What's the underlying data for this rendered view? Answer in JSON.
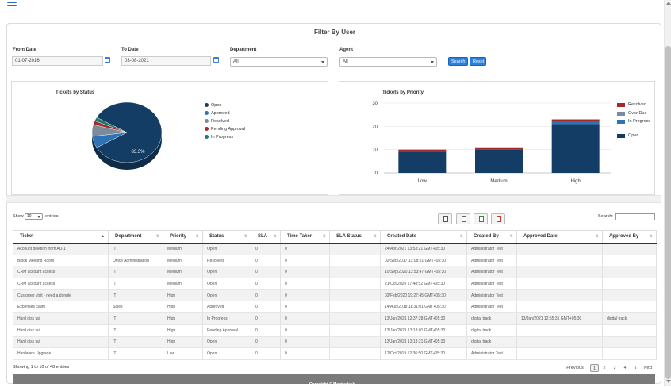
{
  "panel": {
    "title": "Filter By User"
  },
  "filters": {
    "from_date": {
      "label": "From Date",
      "value": "01-07-2016"
    },
    "to_date": {
      "label": "To Date",
      "value": "03-08-2021"
    },
    "department": {
      "label": "Department",
      "value": "All"
    },
    "agent": {
      "label": "Agent",
      "value": "All"
    },
    "search_label": "Search",
    "reset_label": "Reset"
  },
  "status_chart": {
    "title": "Tickets by Status",
    "slice_label": "83.3%",
    "legend": [
      {
        "label": "Open",
        "color": "#143d66"
      },
      {
        "label": "Approved",
        "color": "#2e74b5"
      },
      {
        "label": "Resolved",
        "color": "#7d8a99"
      },
      {
        "label": "Pending Approval",
        "color": "#a52a2a"
      },
      {
        "label": "In Progress",
        "color": "#1f7a6a"
      }
    ]
  },
  "chart_data": [
    {
      "type": "pie",
      "title": "Tickets by Status",
      "labels": [
        "Open",
        "Approved",
        "Resolved",
        "Pending Approval",
        "In Progress"
      ],
      "values": [
        83.3,
        6.3,
        6.3,
        2.1,
        2.0
      ],
      "colors": [
        "#143d66",
        "#2e74b5",
        "#7d8a99",
        "#a52a2a",
        "#1f7a6a"
      ],
      "legend": "right"
    },
    {
      "type": "bar",
      "title": "Tickets by Priority",
      "categories": [
        "Low",
        "Medium",
        "High"
      ],
      "series": [
        {
          "name": "Open",
          "values": [
            9,
            10,
            21
          ],
          "color": "#143d66"
        },
        {
          "name": "In Progress",
          "values": [
            0,
            0,
            1
          ],
          "color": "#2e74b5"
        },
        {
          "name": "Over Due",
          "values": [
            0,
            0,
            0
          ],
          "color": "#7d8a99"
        },
        {
          "name": "Resolved",
          "values": [
            1,
            1,
            1
          ],
          "color": "#a52a2a"
        }
      ],
      "ylim": [
        0,
        30
      ],
      "yticks": [
        0,
        10,
        20,
        30
      ],
      "grid": true,
      "legend": "right",
      "stacked": true
    }
  ],
  "priority_chart": {
    "title": "Tickets by Priority",
    "legend": [
      {
        "label": "Resolved",
        "color": "#a52a2a"
      },
      {
        "label": "Over Due",
        "color": "#7d8a99"
      },
      {
        "label": "In Progress",
        "color": "#2e74b5"
      },
      {
        "label": "Open",
        "color": "#143d66"
      }
    ]
  },
  "table_controls": {
    "show_label": "Show",
    "entries_value": "10",
    "entries_label": "entries",
    "search_label": "Search:",
    "info": "Showing 1 to 10 of 48 entries",
    "previous": "Previous",
    "pages": [
      "1",
      "2",
      "3",
      "4",
      "5"
    ],
    "next": "Next"
  },
  "table": {
    "headers": [
      "Ticket",
      "Department",
      "Priority",
      "Status",
      "SLA",
      "Time Taken",
      "SLA Status",
      "Created Date",
      "Created By",
      "Approved Date",
      "Approved By"
    ],
    "rows": [
      [
        "Account deletion from AD-1",
        "IT",
        "Medium",
        "Open",
        "0",
        "0",
        "",
        "24/Apr/2021 13:53:21 GMT+05:30",
        "Administrator Test",
        "",
        ""
      ],
      [
        "Block Meeting Room",
        "Office Administration",
        "Medium",
        "Resolved",
        "0",
        "0",
        "",
        "02/Sep/2017 13:08:51 GMT+05:30",
        "Administrator Test",
        "",
        ""
      ],
      [
        "CRM account access",
        "IT",
        "Medium",
        "Open",
        "0",
        "0",
        "",
        "10/Sep/2020 13:53:47 GMT+05:30",
        "Administrator Test",
        "",
        ""
      ],
      [
        "CRM account access",
        "IT",
        "Medium",
        "Open",
        "0",
        "0",
        "",
        "21/Oct/2020 17:48:52 GMT+05:30",
        "Administrator Test",
        "",
        ""
      ],
      [
        "Customer visit - need a dongle",
        "IT",
        "High",
        "Open",
        "0",
        "0",
        "",
        "02/Feb/2020 19:27:45 GMT+05:30",
        "Administrator Test",
        "",
        ""
      ],
      [
        "Expenses claim",
        "Sales",
        "High",
        "Approved",
        "0",
        "0",
        "",
        "14/Aug/2018 11:31:01 GMT+05:30",
        "Administrator Test",
        "",
        ""
      ],
      [
        "Hard disk fail",
        "IT",
        "High",
        "In Progress",
        "0",
        "0",
        "",
        "13/Jan/2021 12:37:28 GMT+05:30",
        "digital track",
        "13/Jan/2021 12:55:31 GMT+05:30",
        "digital track"
      ],
      [
        "Hard disk fail",
        "IT",
        "High",
        "Pending Approval",
        "0",
        "0",
        "",
        "13/Jan/2021 13:18:01 GMT+05:30",
        "digital track",
        "",
        ""
      ],
      [
        "Hard disk fail",
        "IT",
        "High",
        "Open",
        "0",
        "0",
        "",
        "13/Jan/2021 13:18:21 GMT+05:30",
        "digital track",
        "",
        ""
      ],
      [
        "Hardware Upgrade",
        "IT",
        "Low",
        "Open",
        "0",
        "0",
        "",
        "17/Oct/2019 12:36:50 GMT+05:30",
        "Administrator Test",
        "",
        ""
      ]
    ]
  },
  "footer": {
    "text": "Copyright © Mantisdesk"
  },
  "icons": [
    "menu-icon",
    "calendar-icon",
    "copy-icon",
    "csv-icon",
    "excel-icon",
    "pdf-icon",
    "sort-icon"
  ]
}
